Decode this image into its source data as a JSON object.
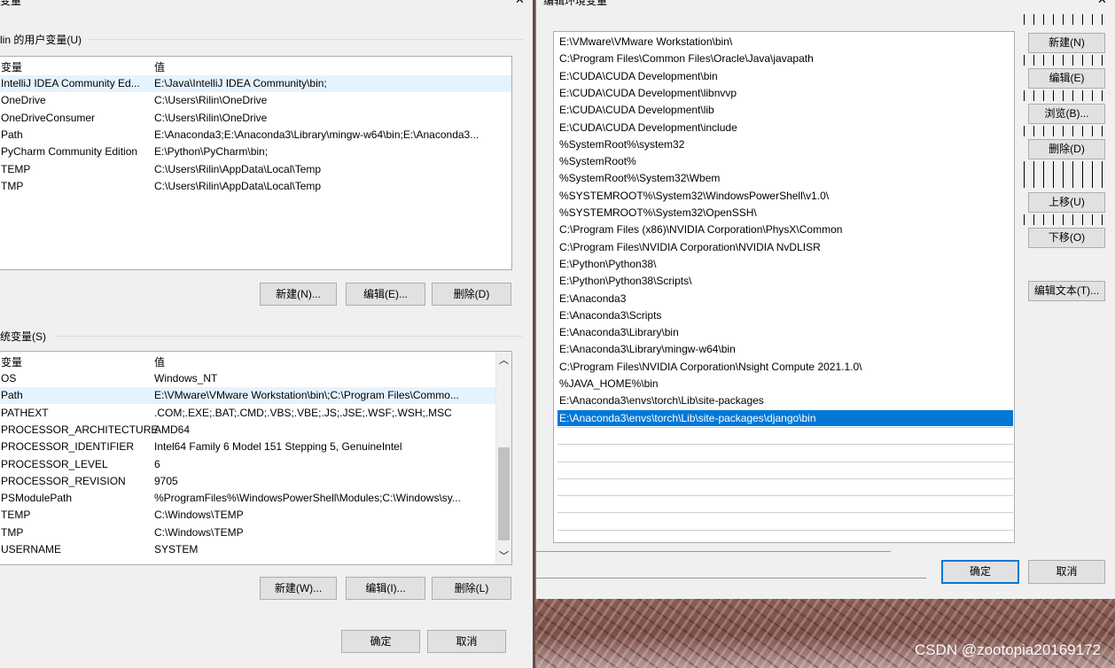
{
  "left_window": {
    "title": "变量",
    "user_group_label": "lin 的用户变量(U)",
    "columns": [
      "变量",
      "值"
    ],
    "user_vars": [
      {
        "name": "IntelliJ IDEA Community Ed...",
        "value": "E:\\Java\\IntelliJ IDEA Community\\bin;"
      },
      {
        "name": "OneDrive",
        "value": "C:\\Users\\Rilin\\OneDrive"
      },
      {
        "name": "OneDriveConsumer",
        "value": "C:\\Users\\Rilin\\OneDrive"
      },
      {
        "name": "Path",
        "value": "E:\\Anaconda3;E:\\Anaconda3\\Library\\mingw-w64\\bin;E:\\Anaconda3..."
      },
      {
        "name": "PyCharm Community Edition",
        "value": "E:\\Python\\PyCharm\\bin;"
      },
      {
        "name": "TEMP",
        "value": "C:\\Users\\Rilin\\AppData\\Local\\Temp"
      },
      {
        "name": "TMP",
        "value": "C:\\Users\\Rilin\\AppData\\Local\\Temp"
      }
    ],
    "user_buttons": {
      "new": "新建(N)...",
      "edit": "编辑(E)...",
      "delete": "删除(D)"
    },
    "system_group_label": "统变量(S)",
    "system_vars": [
      {
        "name": "OS",
        "value": "Windows_NT"
      },
      {
        "name": "Path",
        "value": "E:\\VMware\\VMware Workstation\\bin\\;C:\\Program Files\\Commo..."
      },
      {
        "name": "PATHEXT",
        "value": ".COM;.EXE;.BAT;.CMD;.VBS;.VBE;.JS;.JSE;.WSF;.WSH;.MSC"
      },
      {
        "name": "PROCESSOR_ARCHITECTURE",
        "value": "AMD64"
      },
      {
        "name": "PROCESSOR_IDENTIFIER",
        "value": "Intel64 Family 6 Model 151 Stepping 5, GenuineIntel"
      },
      {
        "name": "PROCESSOR_LEVEL",
        "value": "6"
      },
      {
        "name": "PROCESSOR_REVISION",
        "value": "9705"
      },
      {
        "name": "PSModulePath",
        "value": "%ProgramFiles%\\WindowsPowerShell\\Modules;C:\\Windows\\sy..."
      },
      {
        "name": "TEMP",
        "value": "C:\\Windows\\TEMP"
      },
      {
        "name": "TMP",
        "value": "C:\\Windows\\TEMP"
      },
      {
        "name": "USERNAME",
        "value": "SYSTEM"
      }
    ],
    "system_buttons": {
      "new": "新建(W)...",
      "edit": "编辑(I)...",
      "delete": "删除(L)"
    },
    "ok": "确定",
    "cancel": "取消"
  },
  "right_window": {
    "title": "编辑环境变量",
    "paths": [
      "E:\\VMware\\VMware Workstation\\bin\\",
      "C:\\Program Files\\Common Files\\Oracle\\Java\\javapath",
      "E:\\CUDA\\CUDA Development\\bin",
      "E:\\CUDA\\CUDA Development\\libnvvp",
      "E:\\CUDA\\CUDA Development\\lib",
      "E:\\CUDA\\CUDA Development\\include",
      "%SystemRoot%\\system32",
      "%SystemRoot%",
      "%SystemRoot%\\System32\\Wbem",
      "%SYSTEMROOT%\\System32\\WindowsPowerShell\\v1.0\\",
      "%SYSTEMROOT%\\System32\\OpenSSH\\",
      "C:\\Program Files (x86)\\NVIDIA Corporation\\PhysX\\Common",
      "C:\\Program Files\\NVIDIA Corporation\\NVIDIA NvDLISR",
      "E:\\Python\\Python38\\",
      "E:\\Python\\Python38\\Scripts\\",
      "E:\\Anaconda3",
      "E:\\Anaconda3\\Scripts",
      "E:\\Anaconda3\\Library\\bin",
      "E:\\Anaconda3\\Library\\mingw-w64\\bin",
      "C:\\Program Files\\NVIDIA Corporation\\Nsight Compute 2021.1.0\\",
      "%JAVA_HOME%\\bin",
      "E:\\Anaconda3\\envs\\torch\\Lib\\site-packages",
      "E:\\Anaconda3\\envs\\torch\\Lib\\site-packages\\django\\bin"
    ],
    "selected_index": 22,
    "side_buttons": {
      "new": "新建(N)",
      "edit": "编辑(E)",
      "browse": "浏览(B)...",
      "delete": "删除(D)",
      "move_up": "上移(U)",
      "move_down": "下移(O)",
      "edit_text": "编辑文本(T)..."
    },
    "ok": "确定",
    "cancel": "取消"
  },
  "watermark": "CSDN @zootopia20169172"
}
